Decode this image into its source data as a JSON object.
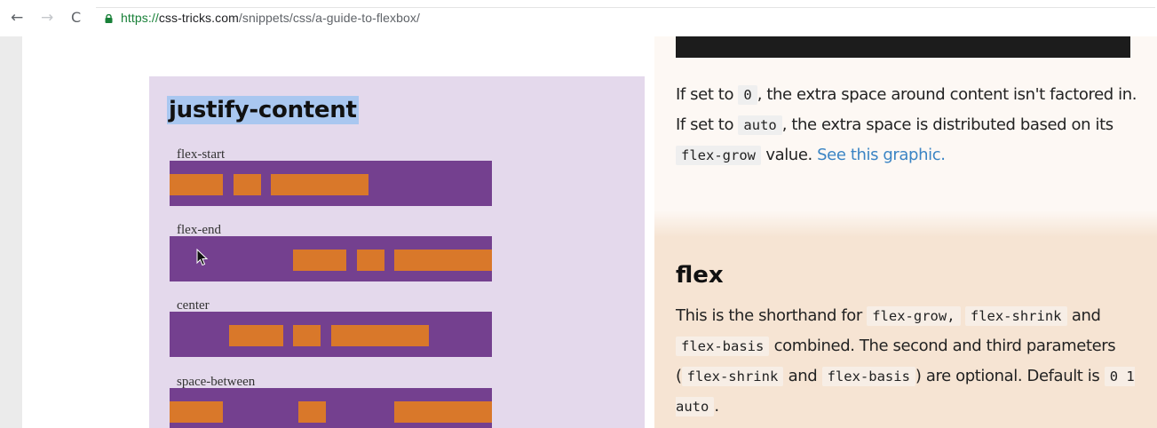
{
  "browser": {
    "url_scheme": "https://",
    "url_host": "css-tricks.com",
    "url_path": "/snippets/css/a-guide-to-flexbox/"
  },
  "graphic": {
    "title": "justify-content",
    "demos": [
      {
        "label": "flex-start"
      },
      {
        "label": "flex-end"
      },
      {
        "label": "center"
      },
      {
        "label": "space-between"
      }
    ]
  },
  "right": {
    "para1": {
      "t1": "If set to ",
      "c1": "0",
      "t2": ", the extra space around content isn't factored in. If set to ",
      "c2": "auto",
      "t3": ", the extra space is distributed based on its ",
      "c3": "flex-grow",
      "t4": " value. ",
      "link": "See this graphic."
    },
    "flex": {
      "title": "flex",
      "t1": "This is the shorthand for ",
      "c1": "flex-grow,",
      "t2": " ",
      "c2": "flex-shrink",
      "t3": " and ",
      "c3": "flex-basis",
      "t4": " combined. The second and third parameters (",
      "c4": "flex-shrink",
      "t5": " and ",
      "c5": "flex-basis",
      "t6": ") are optional. Default is ",
      "c6": "0 1 auto",
      "t7": "."
    }
  },
  "colors": {
    "graphic_bg": "#e4d9ec",
    "demo_container": "#74408f",
    "flex_item": "#d9782a",
    "title_highlight": "#a9c7f0",
    "link": "#3a84c4"
  },
  "icons": [
    "back-arrow-icon",
    "forward-arrow-icon",
    "reload-icon",
    "lock-icon",
    "cursor-icon"
  ]
}
